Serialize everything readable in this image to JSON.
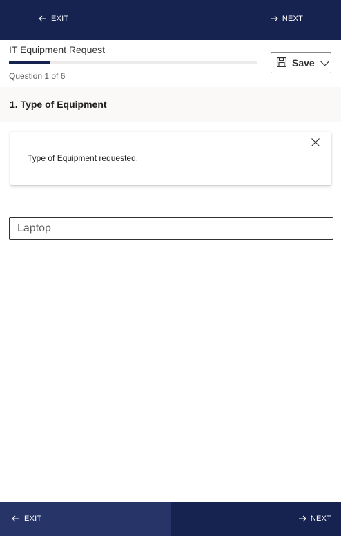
{
  "top_nav": {
    "exit_label": "EXIT",
    "next_label": "NEXT"
  },
  "header": {
    "form_title": "IT Equipment Request",
    "progress_fraction": 0.167,
    "question_counter": "Question 1 of 6",
    "save_label": "Save"
  },
  "question": {
    "title": "1. Type of Equipment",
    "info_text": "Type of Equipment requested.",
    "answer_value": "Laptop"
  },
  "bottom_nav": {
    "exit_label": "EXIT",
    "next_label": "NEXT"
  },
  "colors": {
    "nav_background": "#16224f",
    "exit_highlight": "#273467",
    "progress_fill": "#16224f"
  },
  "icons": {
    "back": "arrow-left-icon",
    "forward": "arrow-right-icon",
    "save": "floppy-disk-icon",
    "dropdown": "chevron-down-icon",
    "close": "close-icon"
  }
}
